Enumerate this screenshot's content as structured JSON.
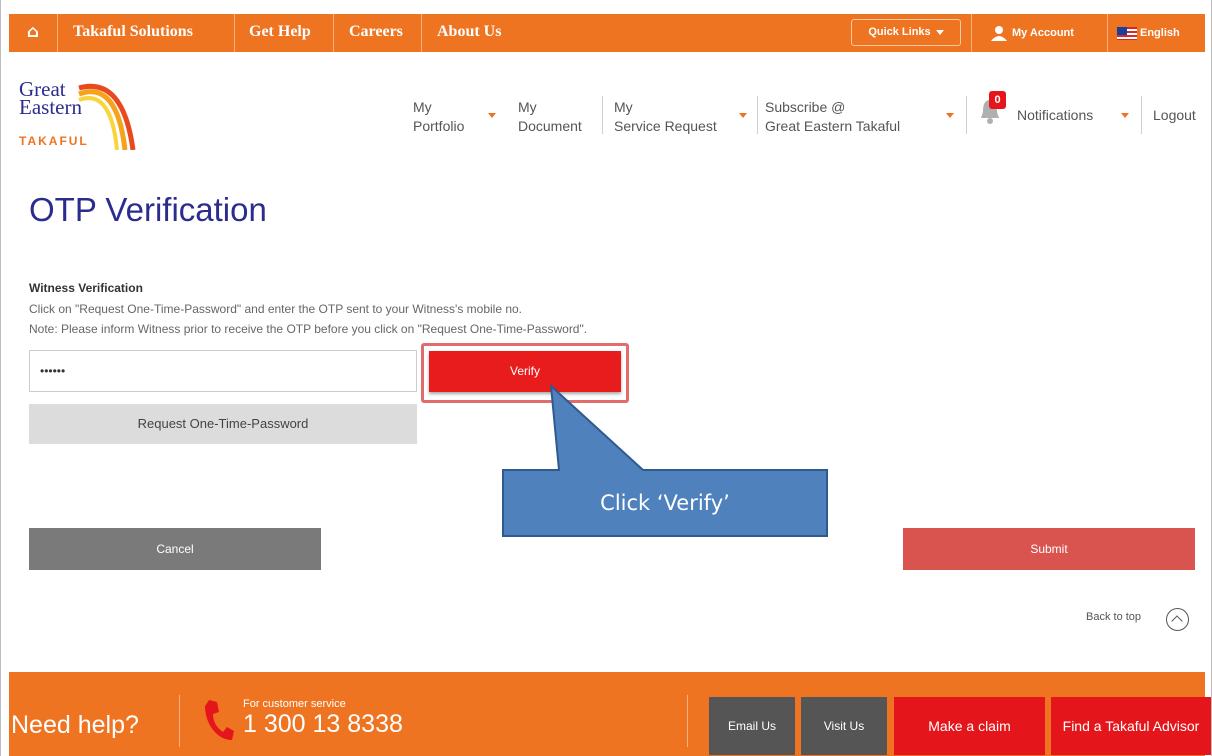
{
  "topbar": {
    "home_icon": "home-icon",
    "items": [
      "Takaful Solutions",
      "Get Help",
      "Careers",
      "About Us"
    ],
    "quick_links": "Quick Links",
    "my_account": "My Account",
    "language": "English"
  },
  "logo": {
    "line1": "Great",
    "line2": "Eastern",
    "line3": "TAKAFUL"
  },
  "nav": {
    "portfolio": [
      "My",
      "Portfolio"
    ],
    "document": [
      "My",
      "Document"
    ],
    "service": [
      "My",
      "Service Request"
    ],
    "subscribe": [
      "Subscribe @",
      "Great Eastern Takaful"
    ],
    "notifications": "Notifications",
    "notification_count": "0",
    "logout": "Logout"
  },
  "main": {
    "title": "OTP Verification",
    "section_heading": "Witness Verification",
    "instruction": "Click on \"Request One-Time-Password\" and enter the OTP sent to your Witness's mobile no.",
    "note": "Note: Please inform Witness prior to receive the OTP before you click on \"Request One-Time-Password\".",
    "otp_value": "••••••",
    "verify_label": "Verify",
    "request_otp_label": "Request One-Time-Password",
    "callout_text": "Click ‘Verify’",
    "cancel_label": "Cancel",
    "submit_label": "Submit",
    "back_to_top": "Back to top"
  },
  "footer": {
    "need_help": "Need help?",
    "customer_service_label": "For customer service",
    "phone_number": "1 300 13 8338",
    "email_us": "Email Us",
    "visit_us": "Visit Us",
    "make_claim": "Make a claim",
    "find_advisor": "Find a Takaful Advisor"
  },
  "colors": {
    "brand_orange": "#ef7421",
    "brand_navy": "#2b2c8e",
    "verify_red": "#e81c1c",
    "submit_red": "#d9534f",
    "callout_blue": "#4f81bd"
  }
}
